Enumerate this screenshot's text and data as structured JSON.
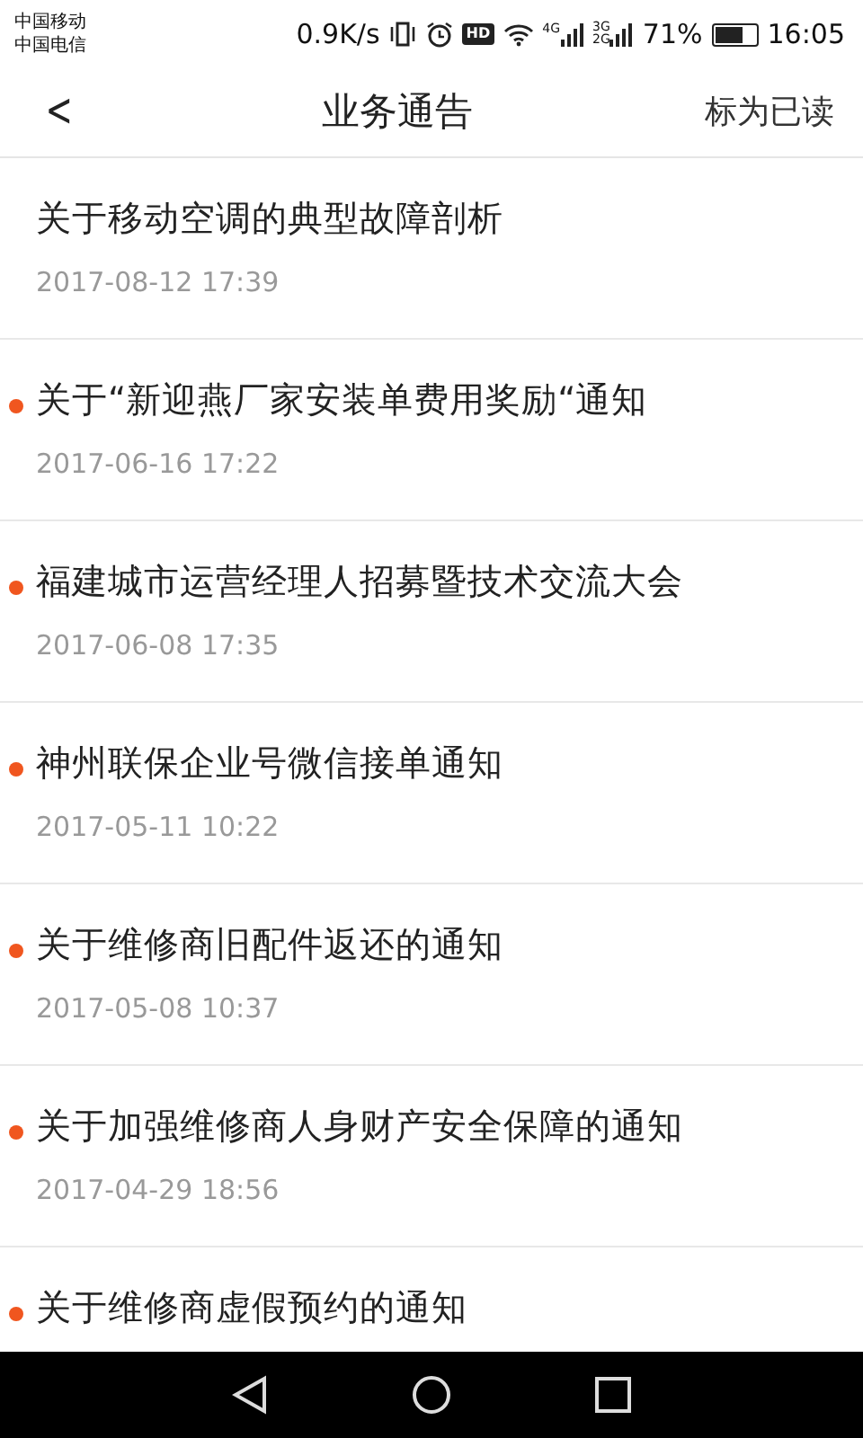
{
  "status_bar": {
    "carriers": [
      "中国移动",
      "中国电信"
    ],
    "speed": "0.9K/s",
    "hd": "HD",
    "net_4g": "4G",
    "net_3g": "3G",
    "net_2g": "2G",
    "battery": "71%",
    "time": "16:05"
  },
  "header": {
    "back": "<",
    "title": "业务通告",
    "action": "标为已读"
  },
  "notices": [
    {
      "title": "关于移动空调的典型故障剖析",
      "date": "2017-08-12 17:39",
      "unread": false
    },
    {
      "title": "关于“新迎燕厂家安装单费用奖励“通知",
      "date": "2017-06-16 17:22",
      "unread": true
    },
    {
      "title": "福建城市运营经理人招募暨技术交流大会",
      "date": "2017-06-08 17:35",
      "unread": true
    },
    {
      "title": "神州联保企业号微信接单通知",
      "date": "2017-05-11 10:22",
      "unread": true
    },
    {
      "title": "关于维修商旧配件返还的通知",
      "date": "2017-05-08 10:37",
      "unread": true
    },
    {
      "title": "关于加强维修商人身财产安全保障的通知",
      "date": "2017-04-29 18:56",
      "unread": true
    },
    {
      "title": "关于维修商虚假预约的通知",
      "unread": true
    }
  ]
}
